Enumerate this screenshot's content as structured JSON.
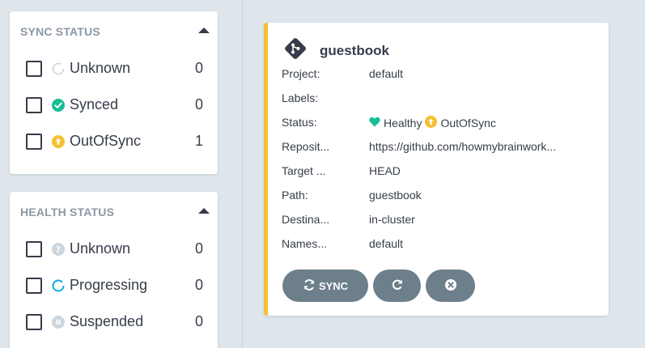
{
  "filters": {
    "sync_status": {
      "title": "SYNC STATUS",
      "items": [
        {
          "label": "Unknown",
          "count": "0",
          "icon": "circle-notch-icon",
          "color": "#ccd6dd"
        },
        {
          "label": "Synced",
          "count": "0",
          "icon": "check-circle-icon",
          "color": "#18be94"
        },
        {
          "label": "OutOfSync",
          "count": "1",
          "icon": "arrow-up-circle-icon",
          "color": "#f4c030"
        }
      ]
    },
    "health_status": {
      "title": "HEALTH STATUS",
      "items": [
        {
          "label": "Unknown",
          "count": "0",
          "icon": "question-circle-icon",
          "color": "#ccd6dd"
        },
        {
          "label": "Progressing",
          "count": "0",
          "icon": "progress-circle-icon",
          "color": "#0dadea"
        },
        {
          "label": "Suspended",
          "count": "0",
          "icon": "pause-circle-icon",
          "color": "#ccd6dd"
        }
      ]
    }
  },
  "app": {
    "name": "guestbook",
    "icon": "git-diamond-icon",
    "accent_color": "#f4c030",
    "fields": {
      "project_label": "Project:",
      "project": "default",
      "labels_label": "Labels:",
      "labels": "",
      "status_label": "Status:",
      "health": "Healthy",
      "health_color": "#18be94",
      "sync": "OutOfSync",
      "sync_color": "#f4c030",
      "repo_label": "Reposit...",
      "repo": "https://github.com/howmybrainwork...",
      "target_label": "Target ...",
      "target": "HEAD",
      "path_label": "Path:",
      "path": "guestbook",
      "dest_label": "Destina...",
      "dest": "in-cluster",
      "ns_label": "Names...",
      "ns": "default"
    },
    "actions": {
      "sync_label": "SYNC"
    }
  }
}
